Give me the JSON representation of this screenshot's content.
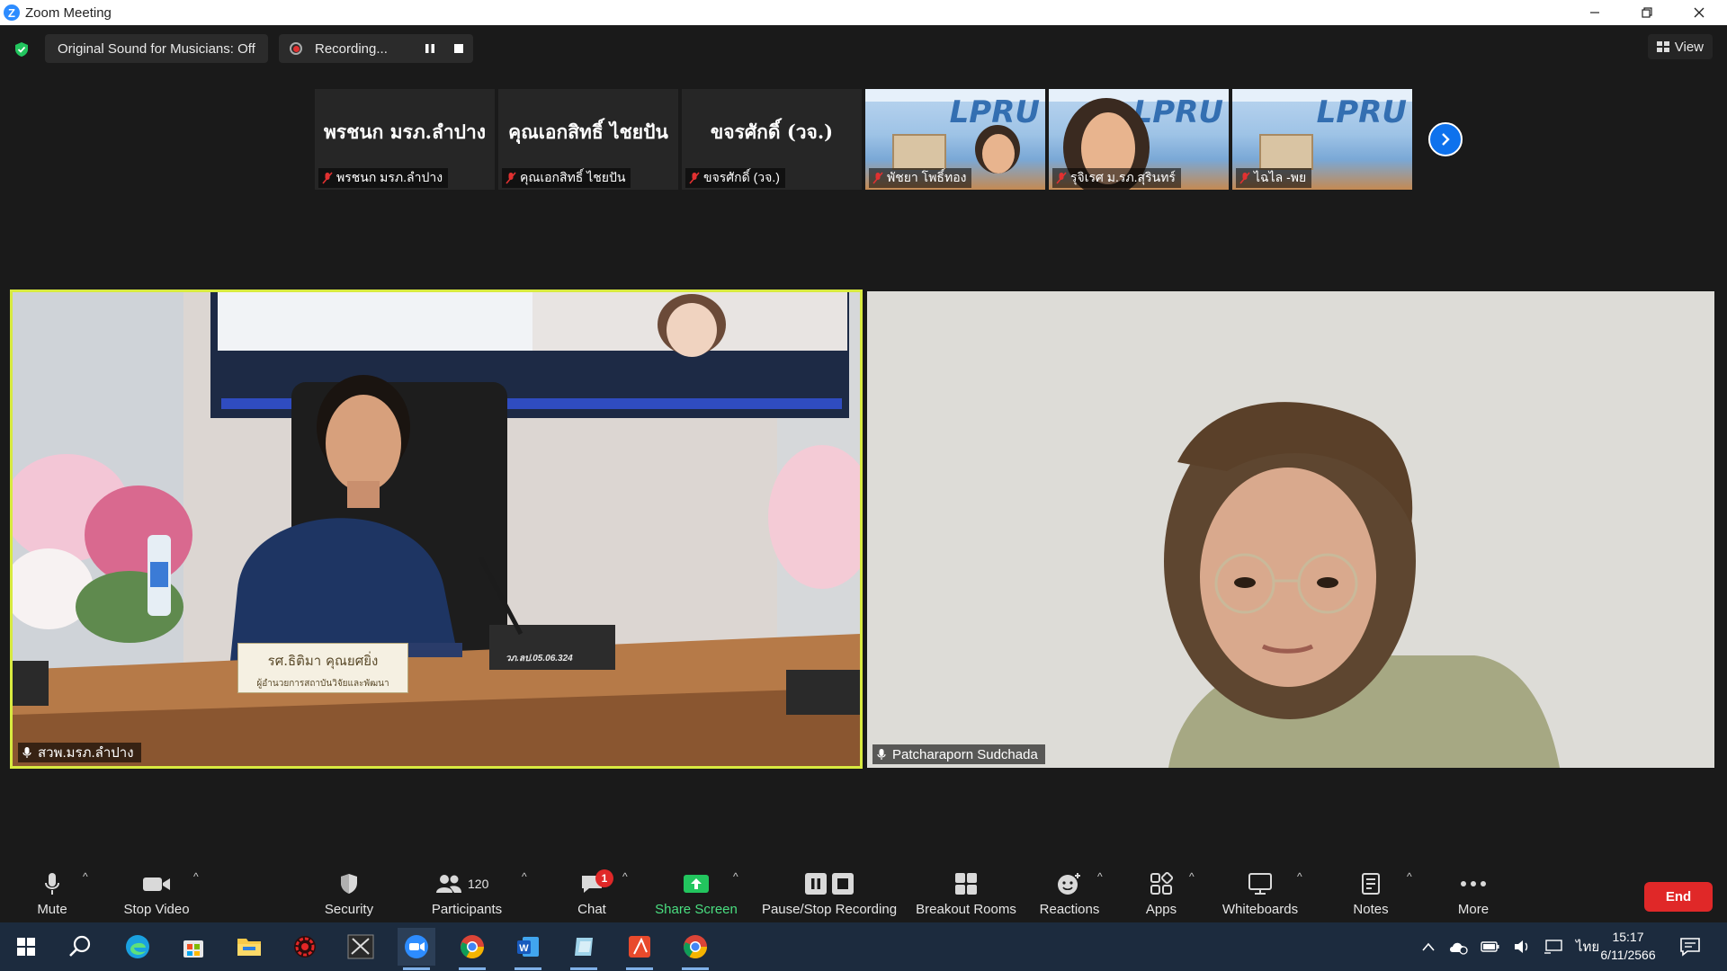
{
  "window": {
    "title": "Zoom Meeting"
  },
  "topbar": {
    "original_sound": "Original Sound for Musicians: Off",
    "recording": "Recording...",
    "view": "View"
  },
  "thumbnails": [
    {
      "big": "พรชนก มรภ.ลำปาง",
      "name": "พรชนก มรภ.ลำปาง"
    },
    {
      "big": "คุณเอกสิทธิ์ ไชยปัน",
      "name": "คุณเอกสิทธิ์ ไชยปัน"
    },
    {
      "big": "ขจรศักดิ์ (วจ.)",
      "name": "ขจรศักดิ์ (วจ.)"
    },
    {
      "name": "พัชยา โพธิ์ทอง"
    },
    {
      "name": "รุจิเรศ ม.รภ.สุรินทร์"
    },
    {
      "name": "ไฉไล -พย"
    }
  ],
  "thumb_logo_text": "LPRU",
  "main_tiles": {
    "left": {
      "name": "สวพ.มรภ.ลำปาง",
      "plaque_name": "รศ.ธิติมา คุณยศยิ่ง",
      "plaque_title": "ผู้อำนวยการสถาบันวิจัยและพัฒนา",
      "mic_tag": "วภ.ลป.05.06.324"
    },
    "right": {
      "name": "Patcharaporn Sudchada"
    }
  },
  "toolbar": {
    "mute": "Mute",
    "stop_video": "Stop Video",
    "security": "Security",
    "participants": "Participants",
    "participants_count": "120",
    "chat": "Chat",
    "chat_badge": "1",
    "share_screen": "Share Screen",
    "pause_stop_recording": "Pause/Stop Recording",
    "breakout_rooms": "Breakout Rooms",
    "reactions": "Reactions",
    "apps": "Apps",
    "whiteboards": "Whiteboards",
    "notes": "Notes",
    "more": "More",
    "end": "End"
  },
  "taskbar": {
    "language": "ไทย",
    "time": "15:17",
    "date": "6/11/2566"
  },
  "colors": {
    "zoom_blue": "#0e72ed",
    "end_red": "#e02828",
    "share_green": "#22c55e",
    "active_speaker_border": "#d8ea40",
    "share_label_green": "#4ade80"
  }
}
